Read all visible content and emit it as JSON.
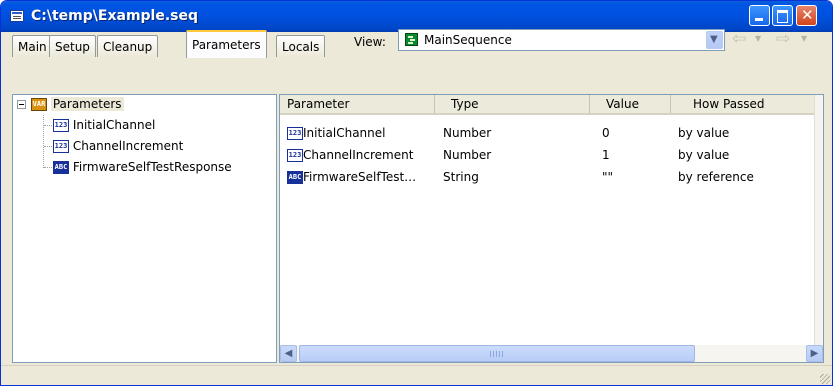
{
  "window": {
    "title": "C:\\temp\\Example.seq"
  },
  "tabs": [
    {
      "label": "Main",
      "active": false
    },
    {
      "label": "Setup",
      "active": false
    },
    {
      "label": "Cleanup",
      "active": false
    },
    {
      "label": "Parameters",
      "active": true
    },
    {
      "label": "Locals",
      "active": false
    }
  ],
  "view": {
    "label": "View:",
    "selected": "MainSequence",
    "icon": "sequence-icon"
  },
  "tree": {
    "root": {
      "label": "Parameters",
      "icon": "variables-icon",
      "expanded": true
    },
    "items": [
      {
        "label": "InitialChannel",
        "icon": "number-icon",
        "icon_text": "123"
      },
      {
        "label": "ChannelIncrement",
        "icon": "number-icon",
        "icon_text": "123"
      },
      {
        "label": "FirmwareSelfTestResponse",
        "icon": "string-icon",
        "icon_text": "ABC"
      }
    ]
  },
  "grid": {
    "columns": [
      "Parameter",
      "Type",
      "Value",
      "How Passed"
    ],
    "rows": [
      {
        "icon_text": "123",
        "parameter": "InitialChannel",
        "type": "Number",
        "value": "0",
        "how_passed": "by value"
      },
      {
        "icon_text": "123",
        "parameter": "ChannelIncrement",
        "type": "Number",
        "value": "1",
        "how_passed": "by value"
      },
      {
        "icon_text": "ABC",
        "parameter": "FirmwareSelfTest…",
        "type": "String",
        "value": "\"\"",
        "how_passed": "by reference"
      }
    ]
  },
  "scroll": {
    "grip": "IIII"
  },
  "icon_glyphs": {
    "var": "VAR",
    "left": "◀",
    "right": "▶",
    "down": "▼",
    "back": "⇦",
    "forward": "⇨",
    "small_down": "▼",
    "close": "✕"
  },
  "colors": {
    "title_bar": "#0055e5",
    "selection": "#ebeadb",
    "window_bg": "#ece9d8"
  }
}
